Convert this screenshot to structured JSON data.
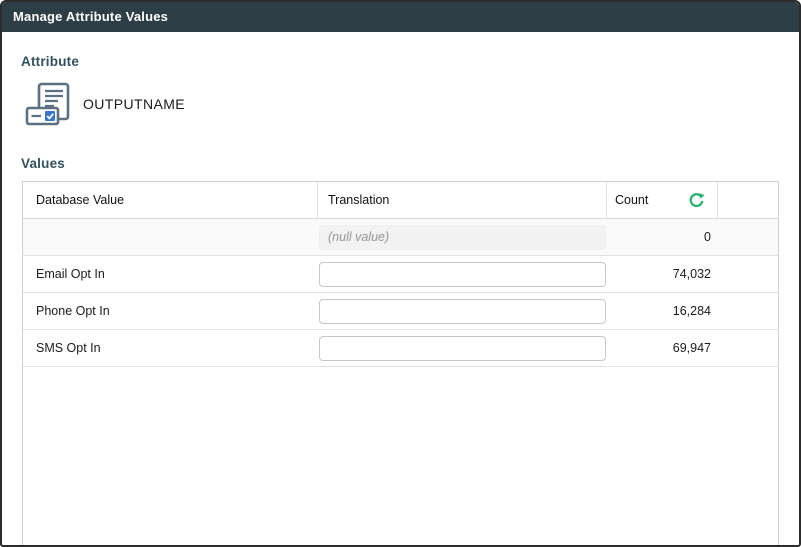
{
  "window": {
    "title": "Manage Attribute Values"
  },
  "attribute_section": {
    "label": "Attribute",
    "attribute_name": "OUTPUTNAME",
    "icon": "attribute-checklist-icon"
  },
  "values_section": {
    "label": "Values",
    "table": {
      "columns": [
        "Database Value",
        "Translation",
        "Count"
      ],
      "refresh_icon": "refresh-icon",
      "rows": [
        {
          "database_value": "",
          "translation_text": "(null value)",
          "translation_disabled": true,
          "count": "0"
        },
        {
          "database_value": "Email Opt In",
          "translation_text": "",
          "translation_disabled": false,
          "count": "74,032"
        },
        {
          "database_value": "Phone Opt In",
          "translation_text": "",
          "translation_disabled": false,
          "count": "16,284"
        },
        {
          "database_value": "SMS Opt In",
          "translation_text": "",
          "translation_disabled": false,
          "count": "69,947"
        }
      ]
    }
  },
  "colors": {
    "titlebar_bg": "#2d3e46",
    "section_label": "#33515c",
    "refresh_green": "#24b26b",
    "icon_slate": "#5d7081",
    "checkbox_blue": "#3a76c5"
  }
}
